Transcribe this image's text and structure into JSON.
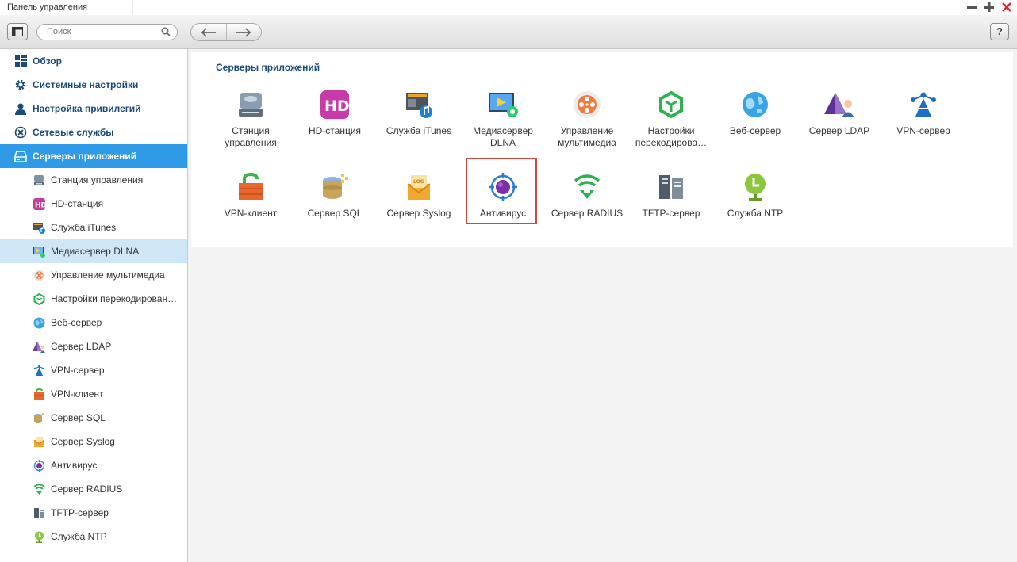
{
  "window": {
    "title": "Панель управления"
  },
  "toolbar": {
    "search_placeholder": "Поиск",
    "help_label": "?"
  },
  "sidebar": {
    "top_items": [
      {
        "label": "Обзор",
        "icon": "grid-icon"
      },
      {
        "label": "Системные настройки",
        "icon": "gear-icon"
      },
      {
        "label": "Настройка привилегий",
        "icon": "user-icon"
      },
      {
        "label": "Сетевые службы",
        "icon": "network-icon"
      },
      {
        "label": "Серверы приложений",
        "icon": "server-apps-icon"
      }
    ],
    "sub_items": [
      {
        "label": "Станция управления",
        "icon": "storage-station-icon"
      },
      {
        "label": "HD-станция",
        "icon": "hd-station-icon"
      },
      {
        "label": "Служба iTunes",
        "icon": "itunes-icon"
      },
      {
        "label": "Медиасервер DLNA",
        "icon": "dlna-icon"
      },
      {
        "label": "Управление мультимедиа",
        "icon": "multimedia-icon"
      },
      {
        "label": "Настройки перекодирован…",
        "icon": "transcode-icon"
      },
      {
        "label": "Веб-сервер",
        "icon": "globe-icon"
      },
      {
        "label": "Сервер LDAP",
        "icon": "ldap-icon"
      },
      {
        "label": "VPN-сервер",
        "icon": "vpn-server-icon"
      },
      {
        "label": "VPN-клиент",
        "icon": "vpn-client-icon"
      },
      {
        "label": "Сервер SQL",
        "icon": "sql-icon"
      },
      {
        "label": "Сервер Syslog",
        "icon": "syslog-icon"
      },
      {
        "label": "Антивирус",
        "icon": "antivirus-icon"
      },
      {
        "label": "Сервер RADIUS",
        "icon": "radius-icon"
      },
      {
        "label": "TFTP-сервер",
        "icon": "tftp-icon"
      },
      {
        "label": "Служба NTP",
        "icon": "ntp-icon"
      }
    ]
  },
  "main": {
    "section_title": "Серверы приложений",
    "apps_row1": [
      {
        "label": "Станция управления",
        "icon": "storage-station-icon"
      },
      {
        "label": "HD-станция",
        "icon": "hd-station-icon"
      },
      {
        "label": "Служба iTunes",
        "icon": "itunes-icon"
      },
      {
        "label": "Медиасервер DLNA",
        "icon": "dlna-icon"
      },
      {
        "label": "Управление мультимедиа",
        "icon": "multimedia-icon"
      },
      {
        "label": "Настройки перекодирова…",
        "icon": "transcode-icon"
      },
      {
        "label": "Веб-сервер",
        "icon": "globe-icon"
      },
      {
        "label": "Сервер LDAP",
        "icon": "ldap-icon"
      },
      {
        "label": "VPN-сервер",
        "icon": "vpn-server-icon"
      }
    ],
    "apps_row2": [
      {
        "label": "VPN-клиент",
        "icon": "vpn-client-icon"
      },
      {
        "label": "Сервер SQL",
        "icon": "sql-icon"
      },
      {
        "label": "Сервер Syslog",
        "icon": "syslog-icon"
      },
      {
        "label": "Антивирус",
        "icon": "antivirus-icon"
      },
      {
        "label": "Сервер RADIUS",
        "icon": "radius-icon"
      },
      {
        "label": "TFTP-сервер",
        "icon": "tftp-icon"
      },
      {
        "label": "Служба NTP",
        "icon": "ntp-icon"
      }
    ]
  },
  "colors": {
    "accent": "#2f9be6",
    "selected_row": "#cfe6f7",
    "highlight_border": "#d9443a",
    "heading": "#1a4a7a"
  }
}
